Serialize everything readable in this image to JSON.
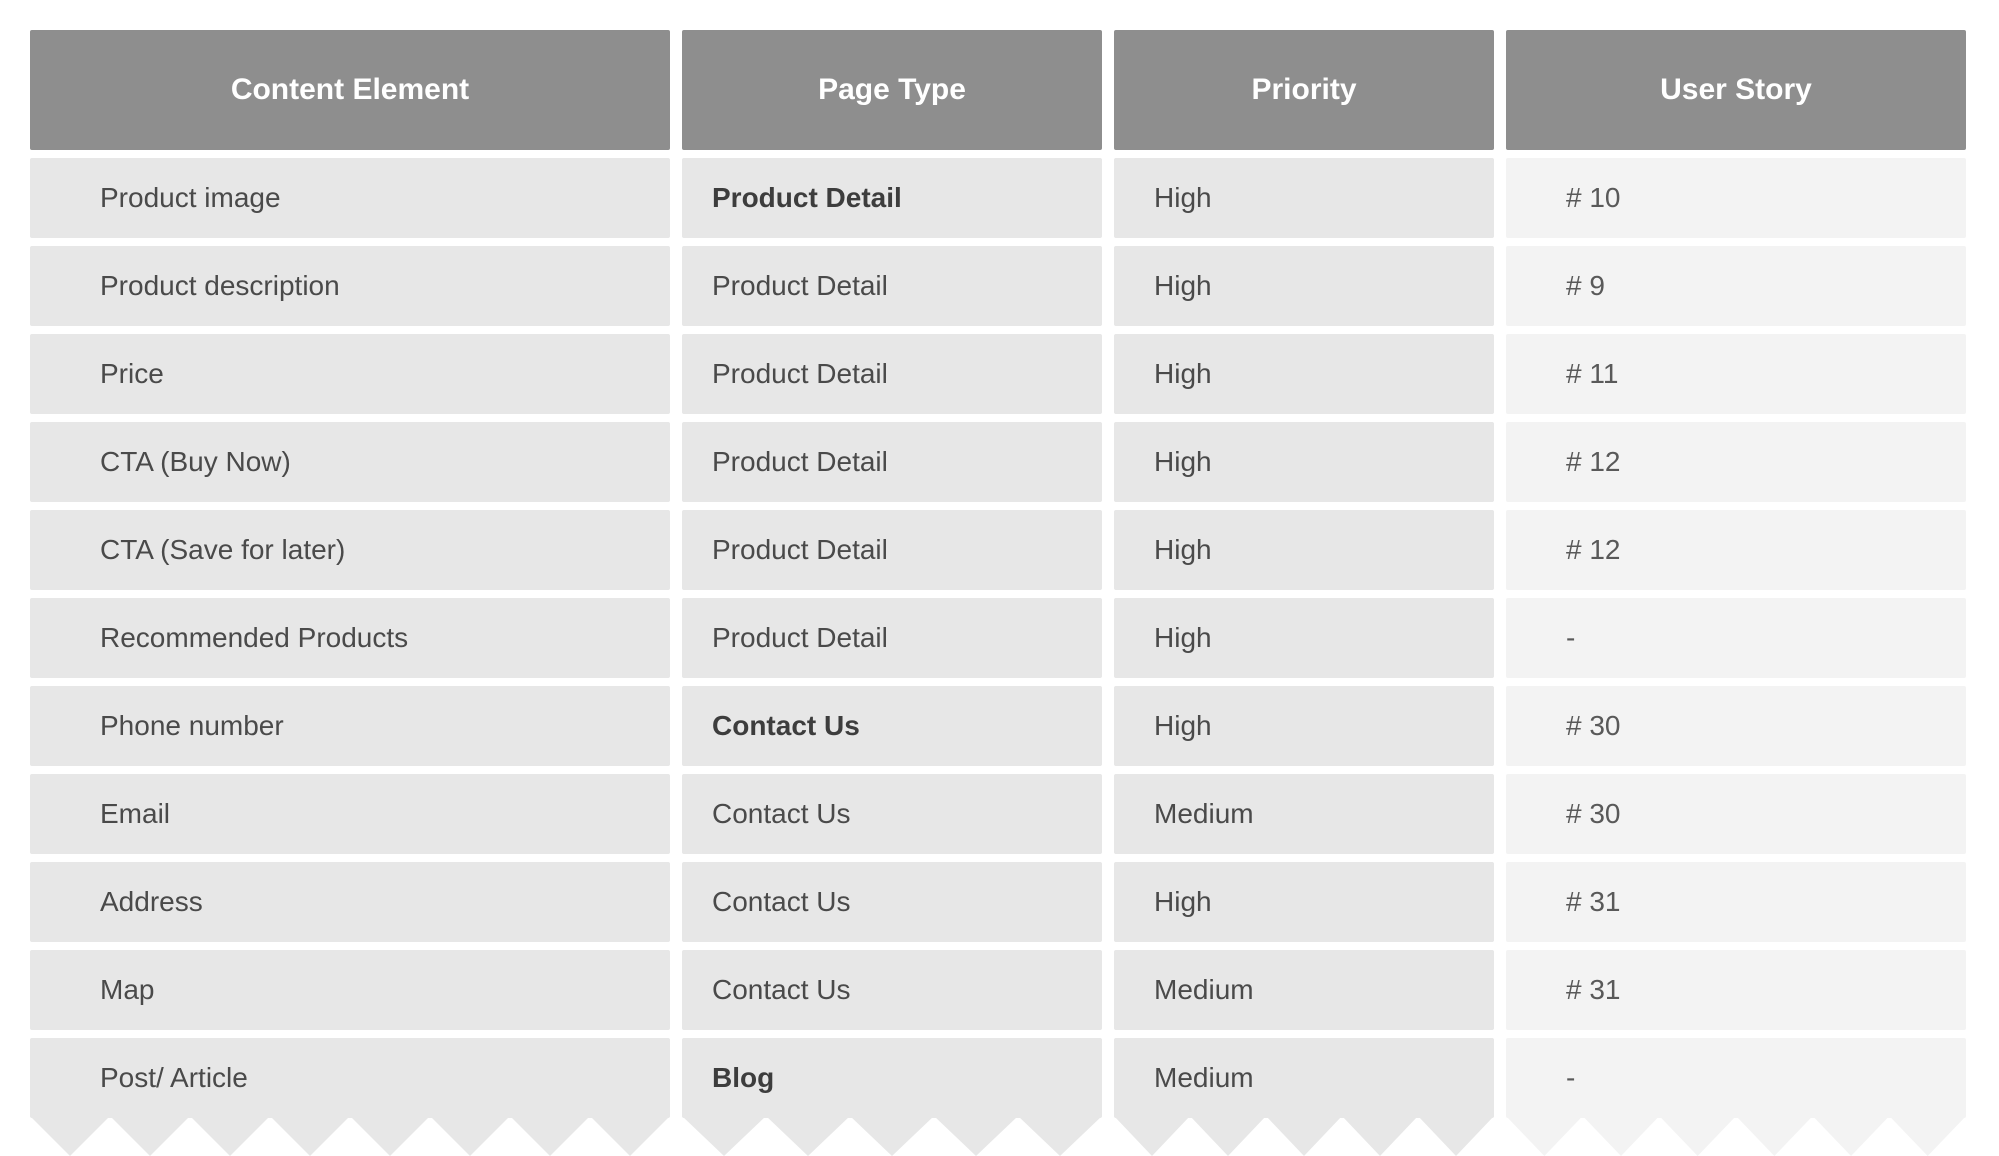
{
  "headers": {
    "content_element": "Content Element",
    "page_type": "Page Type",
    "priority": "Priority",
    "user_story": "User Story"
  },
  "rows": [
    {
      "content_element": "Product image",
      "page_type": "Product Detail",
      "page_type_bold": true,
      "priority": "High",
      "user_story": "# 10"
    },
    {
      "content_element": "Product description",
      "page_type": "Product Detail",
      "page_type_bold": false,
      "priority": "High",
      "user_story": "# 9"
    },
    {
      "content_element": "Price",
      "page_type": "Product Detail",
      "page_type_bold": false,
      "priority": "High",
      "user_story": "# 11"
    },
    {
      "content_element": "CTA (Buy Now)",
      "page_type": "Product Detail",
      "page_type_bold": false,
      "priority": "High",
      "user_story": "# 12"
    },
    {
      "content_element": "CTA (Save for later)",
      "page_type": "Product Detail",
      "page_type_bold": false,
      "priority": "High",
      "user_story": "# 12"
    },
    {
      "content_element": "Recommended Products",
      "page_type": "Product Detail",
      "page_type_bold": false,
      "priority": "High",
      "user_story": "-"
    },
    {
      "content_element": "Phone number",
      "page_type": "Contact Us",
      "page_type_bold": true,
      "priority": "High",
      "user_story": "# 30"
    },
    {
      "content_element": "Email",
      "page_type": "Contact Us",
      "page_type_bold": false,
      "priority": "Medium",
      "user_story": "# 30"
    },
    {
      "content_element": "Address",
      "page_type": "Contact Us",
      "page_type_bold": false,
      "priority": "High",
      "user_story": "# 31"
    },
    {
      "content_element": "Map",
      "page_type": "Contact Us",
      "page_type_bold": false,
      "priority": "Medium",
      "user_story": "# 31"
    },
    {
      "content_element": "Post/ Article",
      "page_type": "Blog",
      "page_type_bold": true,
      "priority": "Medium",
      "user_story": "-"
    }
  ]
}
